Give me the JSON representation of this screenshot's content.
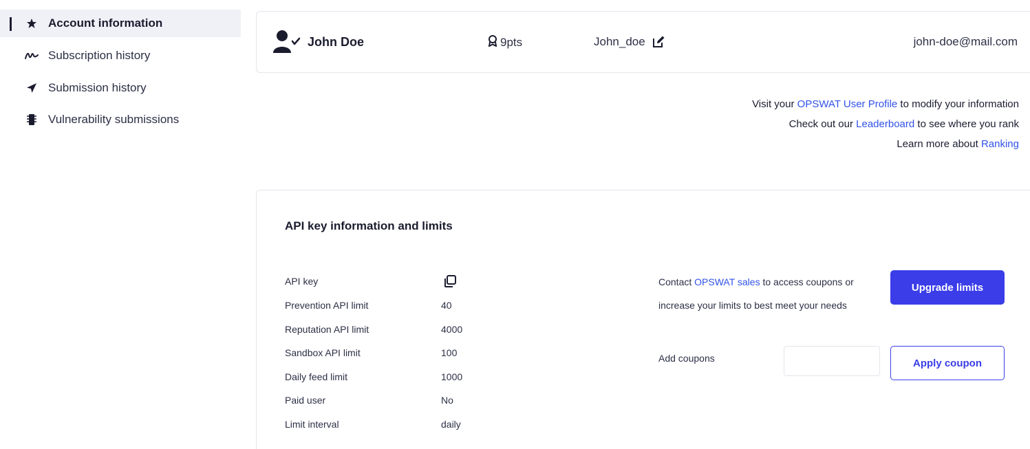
{
  "sidebar": {
    "items": [
      {
        "label": "Account information",
        "icon": "star-icon",
        "active": true
      },
      {
        "label": "Subscription history",
        "icon": "signature-icon",
        "active": false
      },
      {
        "label": "Submission history",
        "icon": "send-icon",
        "active": false
      },
      {
        "label": "Vulnerability submissions",
        "icon": "chip-icon",
        "active": false
      }
    ]
  },
  "profile": {
    "name": "John Doe",
    "points": "9pts",
    "username": "John_doe",
    "email": "john-doe@mail.com"
  },
  "info": {
    "line1_prefix": "Visit your ",
    "line1_link": "OPSWAT User Profile",
    "line1_suffix": " to modify your information",
    "line2_prefix": "Check out our ",
    "line2_link": "Leaderboard",
    "line2_suffix": " to see where you rank",
    "line3_prefix": "Learn more about ",
    "line3_link": "Ranking"
  },
  "api": {
    "title": "API key information and limits",
    "rows": [
      {
        "label": "API key",
        "value": ""
      },
      {
        "label": "Prevention API limit",
        "value": "40"
      },
      {
        "label": "Reputation API limit",
        "value": "4000"
      },
      {
        "label": "Sandbox API limit",
        "value": "100"
      },
      {
        "label": "Daily feed limit",
        "value": "1000"
      },
      {
        "label": "Paid user",
        "value": "No"
      },
      {
        "label": "Limit interval",
        "value": "daily"
      }
    ],
    "contact_prefix": "Contact ",
    "contact_link": "OPSWAT sales",
    "contact_suffix": " to access coupons or increase your limits to best meet your needs",
    "upgrade_label": "Upgrade limits",
    "coupon_label": "Add coupons",
    "coupon_value": "",
    "coupon_placeholder": "",
    "apply_label": "Apply coupon"
  },
  "colors": {
    "accent": "#3a3de8",
    "link": "#3152e8",
    "active_bg": "#f0f1f6"
  }
}
